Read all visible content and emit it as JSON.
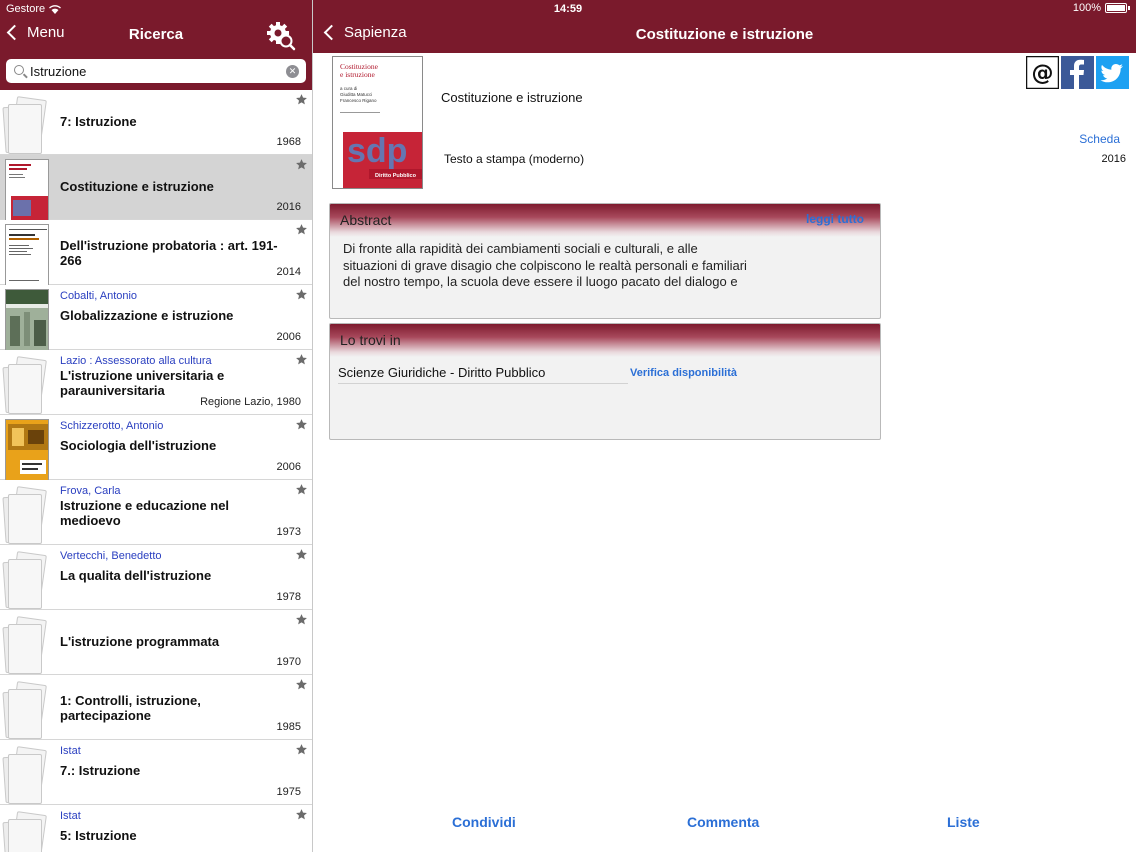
{
  "status": {
    "carrier": "Gestore",
    "time": "14:59",
    "battery": "100%"
  },
  "left_nav": {
    "back_label": "Menu",
    "title": "Ricerca",
    "settings_icon": "gear-search-icon"
  },
  "right_nav": {
    "back_label": "Sapienza",
    "title": "Costituzione e istruzione"
  },
  "search": {
    "value": "Istruzione"
  },
  "results": [
    {
      "author": "",
      "title": "7: Istruzione",
      "year": "1968",
      "thumb": "doc"
    },
    {
      "author": "",
      "title": "Costituzione e istruzione",
      "year": "2016",
      "thumb": "cover-red",
      "selected": true
    },
    {
      "author": "",
      "title": "Dell'istruzione probatoria : art. 191-266",
      "year": "2014",
      "thumb": "cover-white"
    },
    {
      "author": "Cobalti, Antonio",
      "title": "Globalizzazione e istruzione",
      "year": "2006",
      "thumb": "cover-green"
    },
    {
      "author": "Lazio : Assessorato alla cultura",
      "title": "L'istruzione universitaria e parauniversitaria",
      "year": "Regione Lazio, 1980",
      "thumb": "doc"
    },
    {
      "author": "Schizzerotto, Antonio",
      "title": "Sociologia dell'istruzione",
      "year": "2006",
      "thumb": "cover-orange"
    },
    {
      "author": "Frova, Carla",
      "title": "Istruzione e educazione nel medioevo",
      "year": "1973",
      "thumb": "doc"
    },
    {
      "author": "Vertecchi, Benedetto",
      "title": "La qualita dell'istruzione",
      "year": "1978",
      "thumb": "doc"
    },
    {
      "author": "",
      "title": "L'istruzione programmata",
      "year": "1970",
      "thumb": "doc"
    },
    {
      "author": "",
      "title": "1: Controlli, istruzione, partecipazione",
      "year": "1985",
      "thumb": "doc"
    },
    {
      "author": "Istat",
      "title": "7.: Istruzione",
      "year": "1975",
      "thumb": "doc"
    },
    {
      "author": "Istat",
      "title": "5: Istruzione",
      "year": "",
      "thumb": "doc"
    }
  ],
  "detail": {
    "title": "Costituzione e istruzione",
    "scheda_label": "Scheda",
    "type": "Testo a stampa (moderno)",
    "year": "2016",
    "cover": {
      "title_line1": "Costituzione",
      "title_line2": "e istruzione",
      "editors_prefix": "a cura di",
      "editor1": "Giuditta Matucci",
      "editor2": "Francesco Rigano",
      "logo": "sdp",
      "band_text": "Diritto Pubblico"
    },
    "share": {
      "email": "email-icon",
      "facebook": "facebook-icon",
      "twitter": "twitter-icon"
    }
  },
  "abstract": {
    "heading": "Abstract",
    "read_more": "leggi tutto",
    "line1": "Di fronte alla rapidità dei cambiamenti sociali e culturali, e alle",
    "line2": "situazioni di grave disagio che colpiscono le realtà personali e familiari",
    "line3": "del nostro tempo, la scuola deve essere il luogo pacato del dialogo e"
  },
  "locations": {
    "heading": "Lo trovi in",
    "library": "Scienze Giuridiche - Diritto Pubblico",
    "check_label": "Verifica disponibilità"
  },
  "bottom": {
    "share": "Condividi",
    "comment": "Commenta",
    "lists": "Liste"
  },
  "colors": {
    "brand": "#7a1a2c",
    "link": "#2b6fd6",
    "author": "#2a3fc0"
  }
}
